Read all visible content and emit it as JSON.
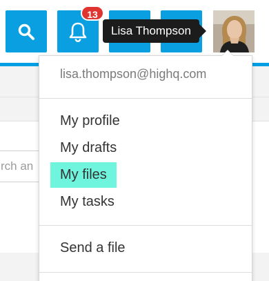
{
  "header": {
    "search_icon": "search-icon",
    "notifications": {
      "icon": "bell-icon",
      "badge_count": "13"
    },
    "tooltip_text": "Lisa Thompson",
    "accent_color": "#009fe3",
    "button_color": "#0a9fe0"
  },
  "background": {
    "search_placeholder_fragment": "rch an"
  },
  "user_menu": {
    "email": "lisa.thompson@highq.com",
    "items": [
      {
        "label": "My profile",
        "active": false
      },
      {
        "label": "My drafts",
        "active": false
      },
      {
        "label": "My files",
        "active": true
      },
      {
        "label": "My tasks",
        "active": false
      }
    ],
    "send_label": "Send a file",
    "highlight_color": "#6ff5de"
  }
}
